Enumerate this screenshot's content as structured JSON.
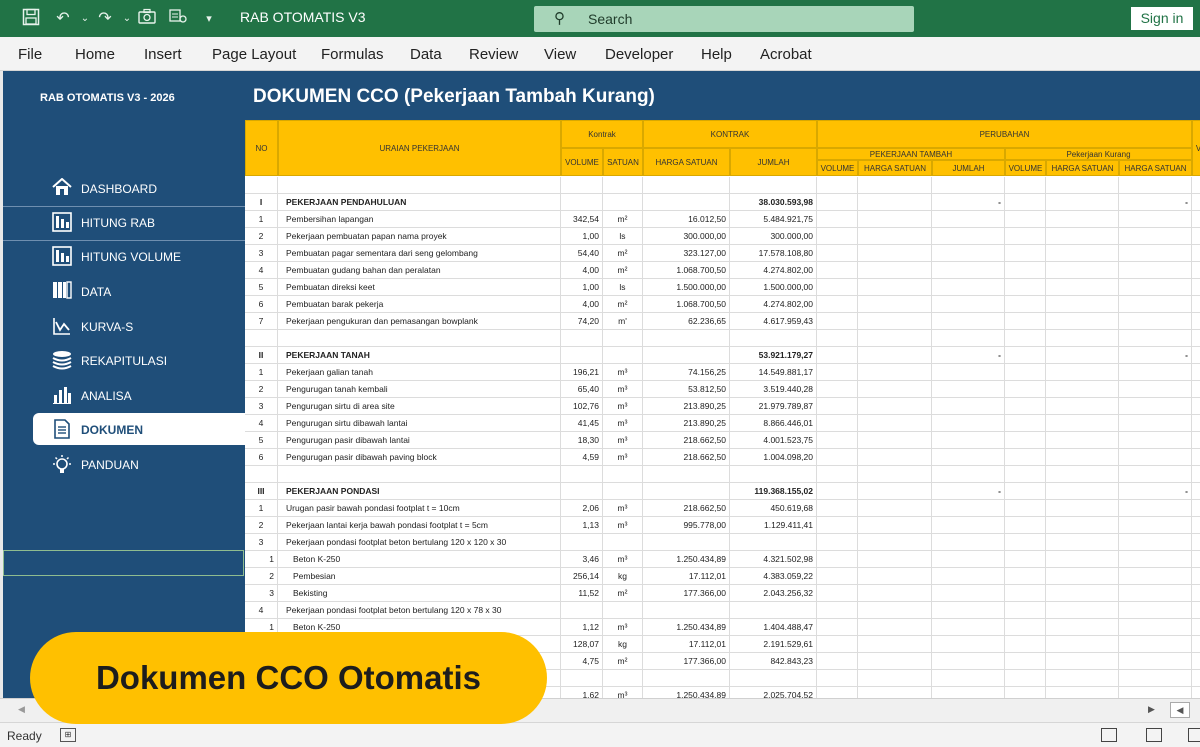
{
  "titlebar": {
    "title": "RAB OTOMATIS V3",
    "search_placeholder": "Search",
    "signin": "Sign in"
  },
  "ribbon": [
    "File",
    "Home",
    "Insert",
    "Page Layout",
    "Formulas",
    "Data",
    "Review",
    "View",
    "Developer",
    "Help",
    "Acrobat"
  ],
  "sidebar": {
    "brand": "RAB OTOMATIS V3 - 2026",
    "items": [
      {
        "label": "DASHBOARD",
        "icon": "home-icon"
      },
      {
        "label": "HITUNG RAB",
        "icon": "calculator-icon"
      },
      {
        "label": "HITUNG VOLUME",
        "icon": "calculator-icon"
      },
      {
        "label": "DATA",
        "icon": "data-icon"
      },
      {
        "label": "KURVA-S",
        "icon": "chart-line-icon"
      },
      {
        "label": "REKAPITULASI",
        "icon": "stack-icon"
      },
      {
        "label": "ANALISA",
        "icon": "bar-chart-icon"
      },
      {
        "label": "DOKUMEN",
        "icon": "document-icon"
      },
      {
        "label": "PANDUAN",
        "icon": "bulb-icon"
      }
    ]
  },
  "doc_title": "DOKUMEN CCO (Pekerjaan Tambah Kurang)",
  "table": {
    "headers": {
      "no": "NO",
      "uraian": "URAIAN PEKERJAAN",
      "kontrak_small": "Kontrak",
      "kontrak": "KONTRAK",
      "perubahan": "PERUBAHAN",
      "tambah": "PEKERJAAN TAMBAH",
      "kurang": "Pekerjaan Kurang",
      "volume": "VOLUME",
      "satuan": "SATUAN",
      "harga_satuan": "HARGA SATUAN",
      "jumlah": "JUMLAH",
      "edge": "V"
    },
    "rows": [
      {
        "type": "blank"
      },
      {
        "type": "section",
        "no": "I",
        "uraian": "PEKERJAAN PENDAHULUAN",
        "jumlah": "38.030.593,98",
        "j2": "-",
        "h4": "-"
      },
      {
        "no": "1",
        "uraian": "Pembersihan lapangan",
        "vol": "342,54",
        "sat": "m²",
        "hs": "16.012,50",
        "jm": "5.484.921,75"
      },
      {
        "no": "2",
        "uraian": "Pekerjaan pembuatan papan nama proyek",
        "vol": "1,00",
        "sat": "ls",
        "hs": "300.000,00",
        "jm": "300.000,00"
      },
      {
        "no": "3",
        "uraian": "Pembuatan pagar sementara dari seng gelombang",
        "vol": "54,40",
        "sat": "m²",
        "hs": "323.127,00",
        "jm": "17.578.108,80"
      },
      {
        "no": "4",
        "uraian": "Pembuatan gudang bahan dan peralatan",
        "vol": "4,00",
        "sat": "m²",
        "hs": "1.068.700,50",
        "jm": "4.274.802,00"
      },
      {
        "no": "5",
        "uraian": "Pembuatan direksi keet",
        "vol": "1,00",
        "sat": "ls",
        "hs": "1.500.000,00",
        "jm": "1.500.000,00"
      },
      {
        "no": "6",
        "uraian": "Pembuatan barak pekerja",
        "vol": "4,00",
        "sat": "m²",
        "hs": "1.068.700,50",
        "jm": "4.274.802,00"
      },
      {
        "no": "7",
        "uraian": "Pekerjaan pengukuran dan pemasangan bowplank",
        "vol": "74,20",
        "sat": "m'",
        "hs": "62.236,65",
        "jm": "4.617.959,43"
      },
      {
        "type": "blank"
      },
      {
        "type": "section",
        "no": "II",
        "uraian": "PEKERJAAN TANAH",
        "jumlah": "53.921.179,27",
        "j2": "-",
        "h4": "-"
      },
      {
        "no": "1",
        "uraian": "Pekerjaan galian tanah",
        "vol": "196,21",
        "sat": "m³",
        "hs": "74.156,25",
        "jm": "14.549.881,17"
      },
      {
        "no": "2",
        "uraian": "Pengurugan tanah kembali",
        "vol": "65,40",
        "sat": "m³",
        "hs": "53.812,50",
        "jm": "3.519.440,28"
      },
      {
        "no": "3",
        "uraian": "Pengurugan sirtu di area site",
        "vol": "102,76",
        "sat": "m³",
        "hs": "213.890,25",
        "jm": "21.979.789,87"
      },
      {
        "no": "4",
        "uraian": "Pengurugan sirtu dibawah lantai",
        "vol": "41,45",
        "sat": "m³",
        "hs": "213.890,25",
        "jm": "8.866.446,01"
      },
      {
        "no": "5",
        "uraian": "Pengurugan pasir dibawah lantai",
        "vol": "18,30",
        "sat": "m³",
        "hs": "218.662,50",
        "jm": "4.001.523,75"
      },
      {
        "no": "6",
        "uraian": "Pengurugan pasir dibawah paving block",
        "vol": "4,59",
        "sat": "m³",
        "hs": "218.662,50",
        "jm": "1.004.098,20"
      },
      {
        "type": "blank"
      },
      {
        "type": "section",
        "no": "III",
        "uraian": "PEKERJAAN PONDASI",
        "jumlah": "119.368.155,02",
        "j2": "-",
        "h4": "-"
      },
      {
        "no": "1",
        "uraian": "Urugan pasir bawah pondasi footplat t = 10cm",
        "vol": "2,06",
        "sat": "m³",
        "hs": "218.662,50",
        "jm": "450.619,68"
      },
      {
        "no": "2",
        "uraian": "Pekerjaan lantai kerja bawah pondasi footplat t = 5cm",
        "vol": "1,13",
        "sat": "m³",
        "hs": "995.778,00",
        "jm": "1.129.411,41"
      },
      {
        "no": "3",
        "uraian": "Pekerjaan pondasi footplat beton bertulang 120 x 120 x 30"
      },
      {
        "type": "sub",
        "no": "1",
        "uraian": "Beton K-250",
        "vol": "3,46",
        "sat": "m³",
        "hs": "1.250.434,89",
        "jm": "4.321.502,98"
      },
      {
        "type": "sub",
        "no": "2",
        "uraian": "Pembesian",
        "vol": "256,14",
        "sat": "kg",
        "hs": "17.112,01",
        "jm": "4.383.059,22"
      },
      {
        "type": "sub",
        "no": "3",
        "uraian": "Bekisting",
        "vol": "11,52",
        "sat": "m²",
        "hs": "177.366,00",
        "jm": "2.043.256,32"
      },
      {
        "no": "4",
        "uraian": "Pekerjaan pondasi footplat beton bertulang 120 x 78 x 30"
      },
      {
        "type": "sub",
        "no": "1",
        "uraian": "Beton K-250",
        "vol": "1,12",
        "sat": "m³",
        "hs": "1.250.434,89",
        "jm": "1.404.488,47"
      },
      {
        "type": "sub",
        "no": "",
        "uraian": "",
        "vol": "128,07",
        "sat": "kg",
        "hs": "17.112,01",
        "jm": "2.191.529,61"
      },
      {
        "type": "sub",
        "no": "",
        "uraian": "",
        "vol": "4,75",
        "sat": "m²",
        "hs": "177.366,00",
        "jm": "842.843,23"
      },
      {
        "type": "blank"
      },
      {
        "type": "sub",
        "no": "",
        "uraian": "",
        "vol": "1,62",
        "sat": "m³",
        "hs": "1.250.434,89",
        "jm": "2.025.704,52"
      }
    ]
  },
  "status": {
    "ready": "Ready"
  },
  "banner": "Dokumen CCO Otomatis",
  "colors": {
    "excel_green": "#217346",
    "navy": "#1f4e79",
    "gold": "#ffc000"
  }
}
